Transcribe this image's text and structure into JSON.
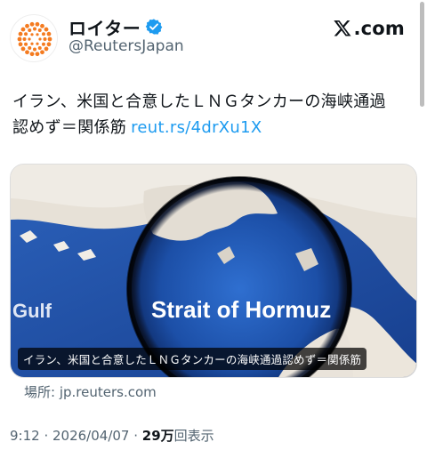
{
  "account": {
    "display_name": "ロイター",
    "handle": "@ReutersJapan",
    "avatar_icon": "reuters-logo-icon",
    "verified_icon": "verified-badge-icon",
    "verified_color": "#1d9bf0"
  },
  "branding": {
    "site": ".com",
    "icon": "x-logo-icon"
  },
  "tweet": {
    "text_line1": "イラン、米国と合意したＬＮＧタンカーの海峡通過",
    "text_line2": "認めず＝関係筋",
    "link": "reut.rs/4drXu1X",
    "link_color": "#1d9bf0"
  },
  "card": {
    "image_label": "Strait of Hormuz",
    "image_label_left": "Gulf",
    "caption": "イラン、米国と合意したＬＮＧタンカーの海峡通過認めず＝関係筋",
    "source": "場所: jp.reuters.com"
  },
  "meta": {
    "time": "9:12",
    "separator": " · ",
    "date": "2026/04/07",
    "separator2": " · ",
    "views_count": "29万",
    "views_label": "回表示"
  },
  "colors": {
    "text": "#0f1419",
    "secondary": "#536471",
    "map_sea": "#1b4fa8",
    "map_land": "#e9e4dc"
  }
}
